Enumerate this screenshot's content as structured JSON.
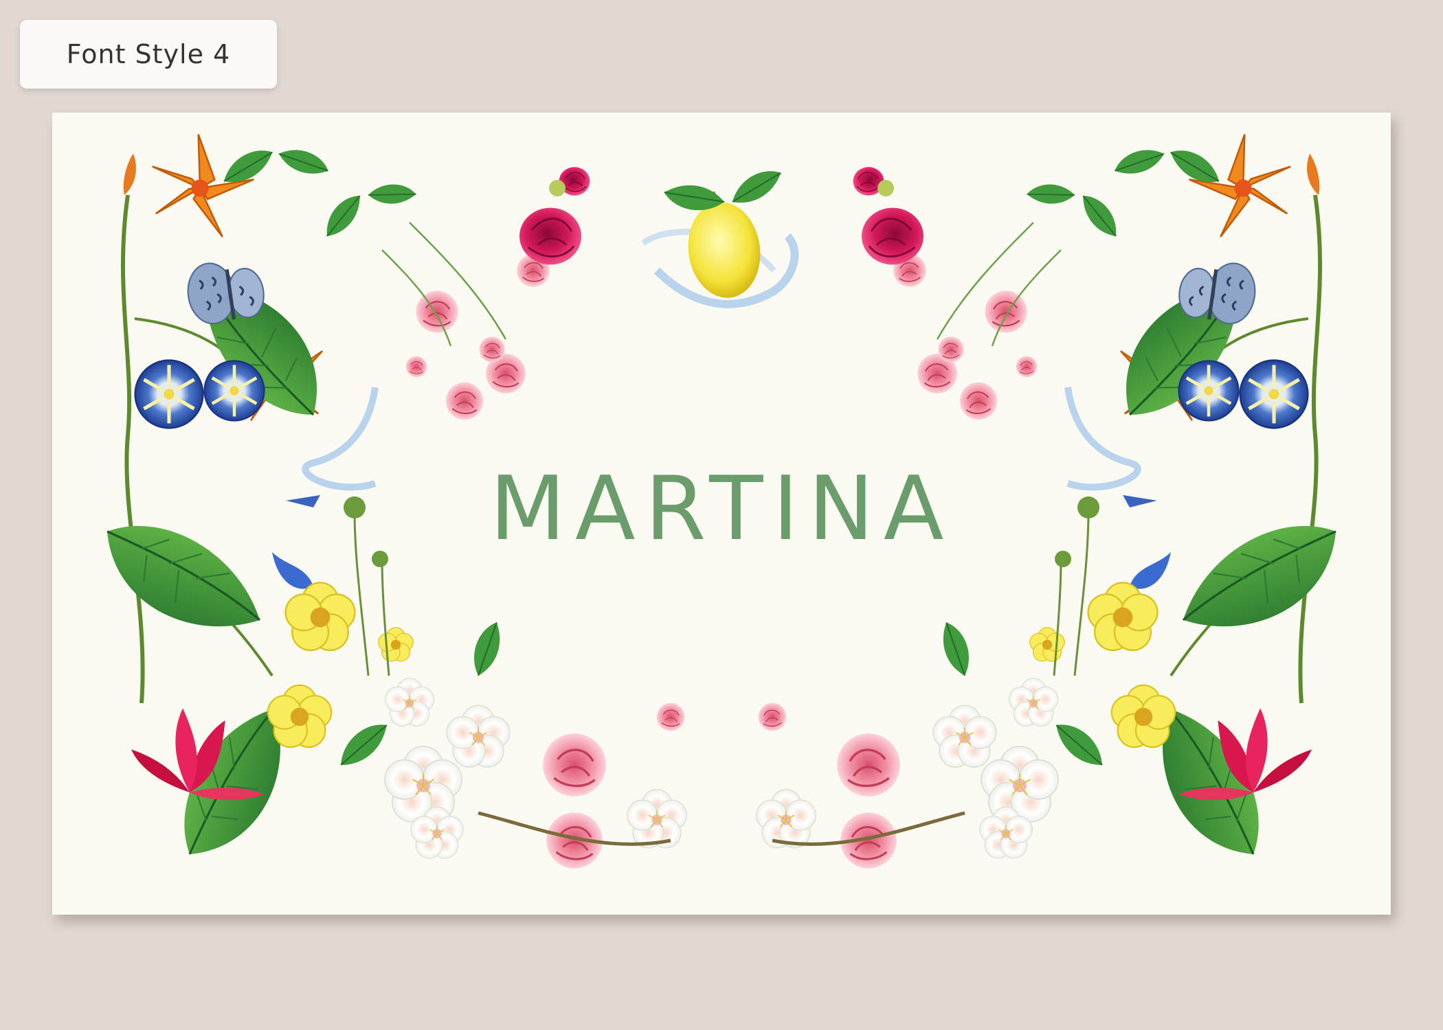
{
  "badge": {
    "label": "Font Style 4"
  },
  "card": {
    "name": "MARTINA"
  },
  "colors": {
    "background": "#e0d8d1",
    "card": "#fbfaf2",
    "name_text": "#6a9c6c",
    "leaf_green": "#3d9a3e",
    "rose_pink": "#ef8fa0",
    "peony_magenta": "#d2175a",
    "lemon_yellow": "#f4e33a",
    "morning_glory_blue": "#2f5fb8",
    "lily_orange": "#f08a1e"
  },
  "illustrations": [
    "botanical-floral-frame",
    "lemon-icon",
    "peony-icon",
    "rose-icon",
    "butterfly-icon",
    "morning-glory-icon",
    "lily-icon",
    "buttercup-icon",
    "blossom-icon",
    "fuchsia-icon",
    "ribbon-icon"
  ]
}
